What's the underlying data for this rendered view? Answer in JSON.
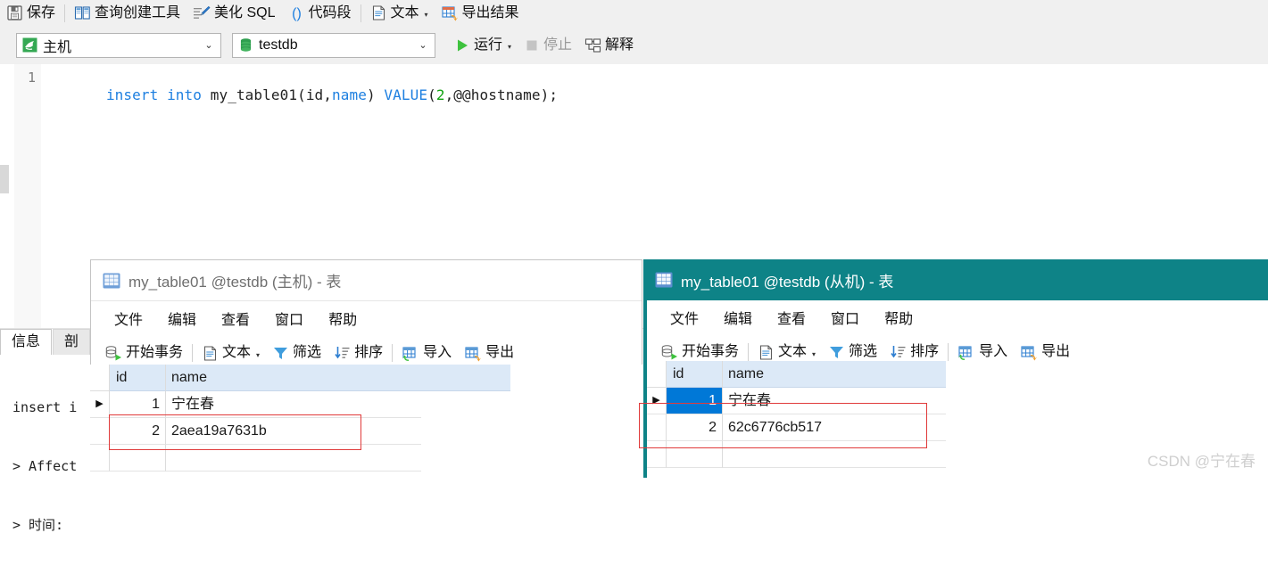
{
  "main_toolbar": {
    "items": [
      {
        "icon": "save-icon",
        "label": "保存"
      },
      {
        "icon": "query-builder-icon",
        "label": "查询创建工具"
      },
      {
        "icon": "beautify-sql-icon",
        "label": "美化 SQL"
      },
      {
        "icon": "code-snippet-icon",
        "label": "代码段"
      },
      {
        "icon": "text-icon",
        "label": "文本",
        "caret": "▾"
      },
      {
        "icon": "export-result-icon",
        "label": "导出结果"
      }
    ]
  },
  "db_toolbar": {
    "host_combo": {
      "icon": "dolphin-icon",
      "value": "主机",
      "arrow": "⌄"
    },
    "db_combo": {
      "icon": "database-icon",
      "value": "testdb",
      "arrow": "⌄"
    },
    "run": {
      "icon": "play-icon",
      "label": "运行",
      "caret": "▾"
    },
    "stop": {
      "icon": "stop-icon",
      "label": "停止"
    },
    "explain": {
      "icon": "explain-icon",
      "label": "解释"
    }
  },
  "editor": {
    "line_number": "1",
    "code": {
      "k1": "insert",
      "sp1": " ",
      "k2": "into",
      "sp2": " ",
      "table": "my_table01",
      "p1": "(",
      "c1": "id",
      "p2": ",",
      "c2": "name",
      "p3": ")",
      "sp3": " ",
      "k3": "VALUE",
      "p4": "(",
      "num": "2",
      "p5": ",",
      "var": "@@hostname",
      "p6": ");"
    },
    "code_full": "insert into my_table01(id,name) VALUE(2,@@hostname);"
  },
  "info_panel": {
    "tabs": [
      {
        "label": "信息",
        "active": true
      },
      {
        "label": "剖",
        "active": false
      }
    ],
    "lines": [
      "insert i",
      "> Affect",
      "> 时间:"
    ]
  },
  "windows": [
    {
      "id": "left",
      "title": "my_table01 @testdb (主机) - 表",
      "title_icon": "table-icon",
      "active": false,
      "menu": [
        "文件",
        "编辑",
        "查看",
        "窗口",
        "帮助"
      ],
      "toolbar": [
        {
          "icon": "begin-transaction-icon",
          "label": "开始事务"
        },
        {
          "icon": "text-icon",
          "label": "文本",
          "caret": "▾"
        },
        {
          "icon": "filter-icon",
          "label": "筛选"
        },
        {
          "icon": "sort-icon",
          "label": "排序"
        },
        {
          "icon": "import-icon",
          "label": "导入"
        },
        {
          "icon": "export-icon",
          "label": "导出"
        }
      ],
      "grid": {
        "columns": [
          "id",
          "name"
        ],
        "rows": [
          {
            "id": "1",
            "name": "宁在春",
            "current": true,
            "id_selected": false
          },
          {
            "id": "2",
            "name": "2aea19a7631b",
            "current": false,
            "id_selected": false
          },
          {
            "id": "",
            "name": "",
            "current": false,
            "id_selected": false
          }
        ],
        "highlight_color": "#e03a3a"
      }
    },
    {
      "id": "right",
      "title": "my_table01 @testdb (从机) - 表",
      "title_icon": "table-icon",
      "active": true,
      "accent_color": "#0e8387",
      "menu": [
        "文件",
        "编辑",
        "查看",
        "窗口",
        "帮助"
      ],
      "toolbar": [
        {
          "icon": "begin-transaction-icon",
          "label": "开始事务"
        },
        {
          "icon": "text-icon",
          "label": "文本",
          "caret": "▾"
        },
        {
          "icon": "filter-icon",
          "label": "筛选"
        },
        {
          "icon": "sort-icon",
          "label": "排序"
        },
        {
          "icon": "import-icon",
          "label": "导入"
        },
        {
          "icon": "export-icon",
          "label": "导出"
        }
      ],
      "grid": {
        "columns": [
          "id",
          "name"
        ],
        "rows": [
          {
            "id": "1",
            "name": "宁在春",
            "current": true,
            "id_selected": true
          },
          {
            "id": "2",
            "name": "62c6776cb517",
            "current": false,
            "id_selected": false
          },
          {
            "id": "",
            "name": "",
            "current": false,
            "id_selected": false
          }
        ],
        "highlight_color": "#e03a3a"
      }
    }
  ],
  "watermark": "CSDN @宁在春",
  "row_marker_glyph": "▶"
}
